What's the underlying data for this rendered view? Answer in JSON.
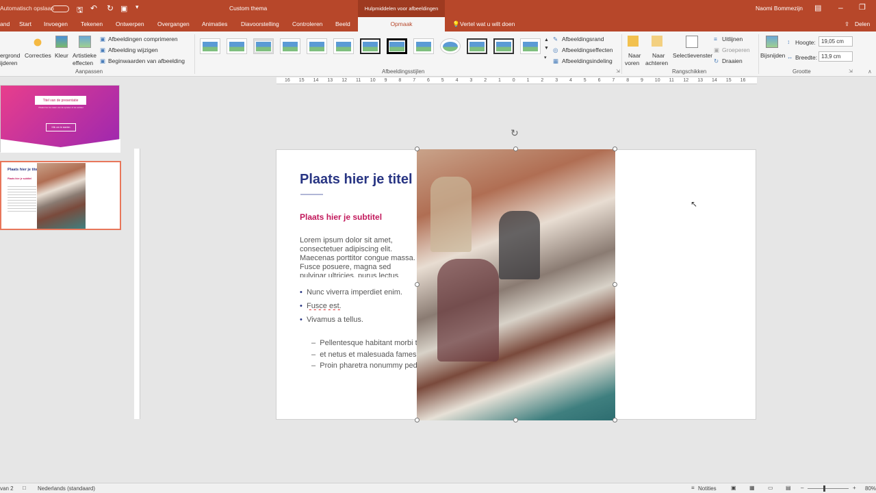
{
  "titlebar": {
    "autosave": "Automatisch opslaan",
    "doc_title": "Custom thema",
    "ctx_header": "Hulpmiddelen voor afbeeldingen",
    "user": "Naomi Bommezijn"
  },
  "tabs": [
    "and",
    "Start",
    "Invoegen",
    "Tekenen",
    "Ontwerpen",
    "Overgangen",
    "Animaties",
    "Diavoorstelling",
    "Controleren",
    "Beeld"
  ],
  "active_tab": "Opmaak",
  "tellme": "Vertel wat u wilt doen",
  "share": "Delen",
  "ribbon": {
    "bg_remove": [
      "ergrond",
      "ijderen"
    ],
    "correcties": "Correcties",
    "kleur": "Kleur",
    "artistieke": [
      "Artistieke",
      "effecten"
    ],
    "aanpassen_items": [
      "Afbeeldingen comprimeren",
      "Afbeelding wijzigen",
      "Beginwaarden van afbeelding"
    ],
    "aanpassen_label": "Aanpassen",
    "stijlen_label": "Afbeeldingsstijlen",
    "style_opts": [
      "Afbeeldingsrand",
      "Afbeeldingseffecten",
      "Afbeeldingsindeling"
    ],
    "naar_voren": [
      "Naar",
      "voren"
    ],
    "naar_achteren": [
      "Naar",
      "achteren"
    ],
    "selectievenster": "Selectievenster",
    "arrange_opts": [
      "Uitlijnen",
      "Groeperen",
      "Draaien"
    ],
    "rangschikken_label": "Rangschikken",
    "bijsnijden": "Bijsnijden",
    "hoogte_label": "Hoogte:",
    "hoogte_value": "19,05 cm",
    "breedte_label": "Breedte:",
    "breedte_value": "13,9 cm",
    "grootte_label": "Grootte"
  },
  "ruler_labels": [
    "16",
    "15",
    "14",
    "13",
    "12",
    "11",
    "10",
    "9",
    "8",
    "7",
    "6",
    "5",
    "4",
    "3",
    "2",
    "1",
    "0",
    "1",
    "2",
    "3",
    "4",
    "5",
    "6",
    "7",
    "8",
    "9",
    "10",
    "11",
    "12",
    "13",
    "14",
    "15",
    "16"
  ],
  "thumb1": {
    "title": "Titel van de presentatie",
    "sub": "Plaats hier de naam van de spreker of de subtitel",
    "btn": "Klik om te starten"
  },
  "thumb2": {
    "title": "Plaats hier je titel",
    "sub": "Plaats hier je subtitel"
  },
  "slide": {
    "title": "Plaats hier je titel",
    "subtitle": "Plaats hier je subtitel",
    "body": "Lorem ipsum dolor sit amet, consectetuer adipiscing elit. Maecenas porttitor congue massa. Fusce posuere, magna sed pulvinar ultricies, purus lectus malesuada libero, sit amet commodo magna eros quis urna.",
    "bullets": [
      "Nunc viverra imperdiet enim.",
      "Fusce est.",
      "Vivamus a tellus."
    ],
    "subbullets": [
      "Pellentesque habitant morbi tristique senectus",
      "et netus et malesuada fames ac turpis egestas.",
      "Proin pharetra nonummy pede."
    ]
  },
  "statusbar": {
    "slide": "van 2",
    "language": "Nederlands (standaard)",
    "notes": "Notities",
    "zoom": "80%"
  }
}
